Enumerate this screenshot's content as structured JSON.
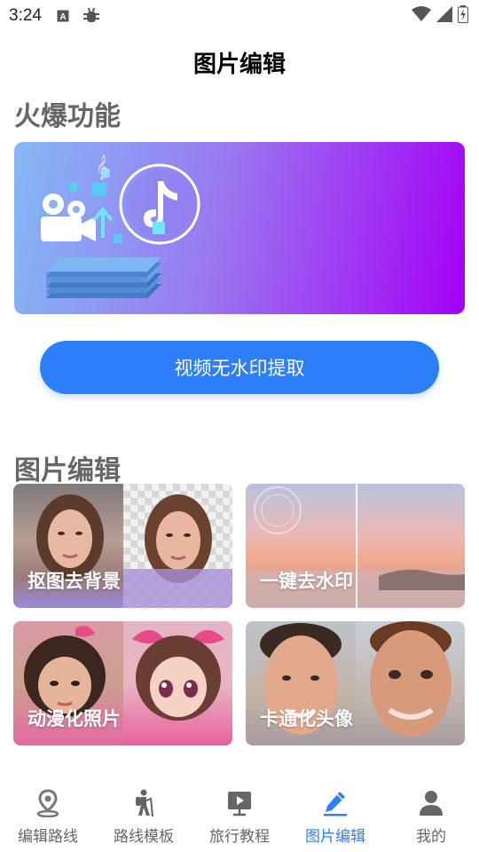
{
  "status": {
    "time": "3:24"
  },
  "header": {
    "title": "图片编辑"
  },
  "hot": {
    "section_title": "火爆功能",
    "extract_button": "视频无水印提取"
  },
  "editing": {
    "section_title": "图片编辑",
    "cards": [
      {
        "label": "抠图去背景"
      },
      {
        "label": "一键去水印"
      },
      {
        "label": "动漫化照片"
      },
      {
        "label": "卡通化头像"
      }
    ]
  },
  "nav": {
    "items": [
      {
        "label": "编辑路线",
        "icon": "location-pin-icon"
      },
      {
        "label": "路线模板",
        "icon": "hiker-icon"
      },
      {
        "label": "旅行教程",
        "icon": "video-board-icon"
      },
      {
        "label": "图片编辑",
        "icon": "pencil-icon",
        "active": true
      },
      {
        "label": "我的",
        "icon": "user-icon"
      }
    ],
    "active_color": "#2d7ff9",
    "inactive_color": "#666666"
  },
  "colors": {
    "accent": "#2d7ff9",
    "banner_start": "#84b8f5",
    "banner_end": "#a500f6"
  }
}
